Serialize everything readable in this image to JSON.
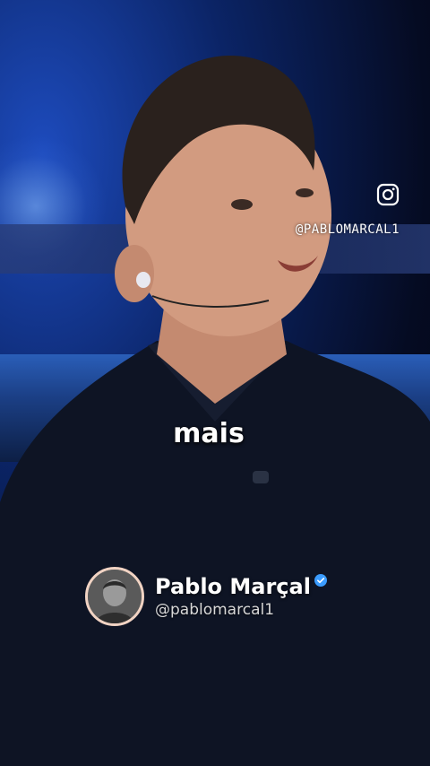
{
  "overlay": {
    "instagram_icon": "instagram-icon",
    "handle": "@PABLOMARCAL1"
  },
  "caption": {
    "text": "mais"
  },
  "profile": {
    "name": "Pablo Marçal",
    "handle": "@pablomarcal1",
    "verified_icon": "verified-badge-icon",
    "verified_color": "#3b9cff"
  },
  "colors": {
    "background": "#0b2466",
    "shirt": "#0e1424",
    "avatar_ring": "#f1d3c3"
  }
}
